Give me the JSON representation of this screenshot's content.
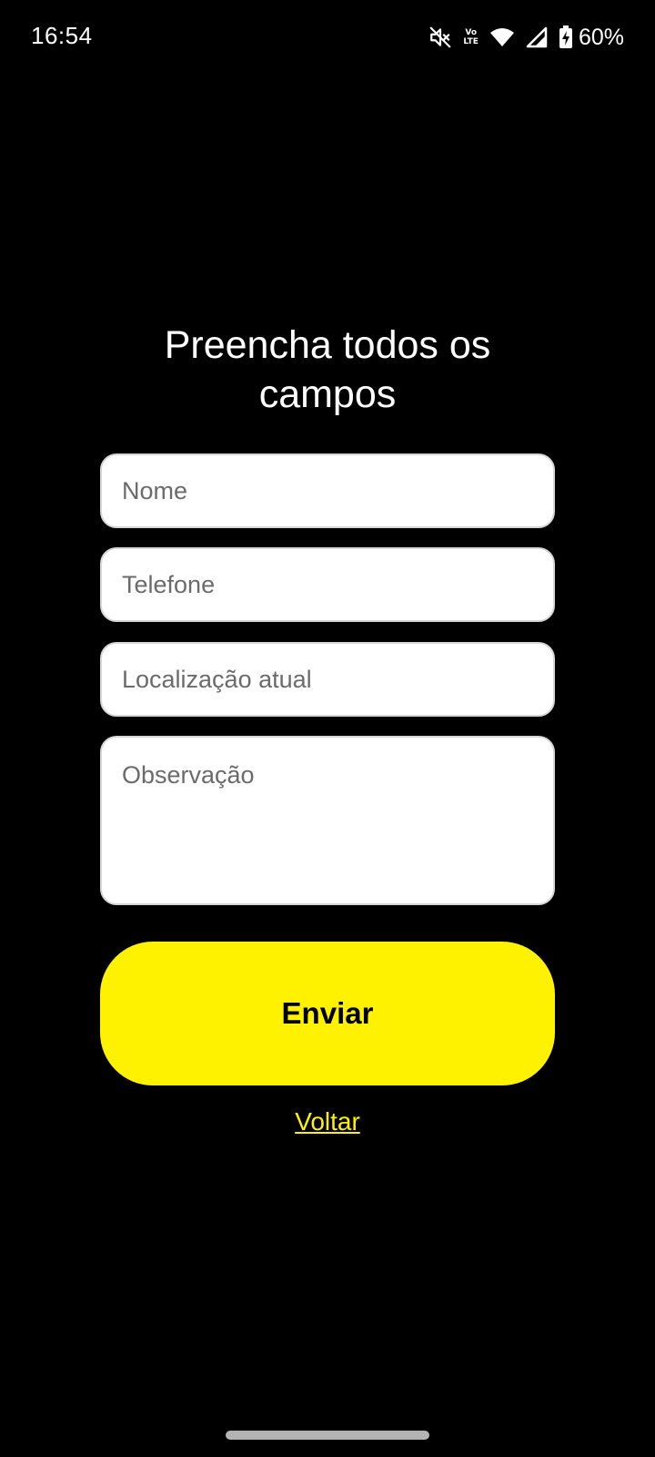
{
  "status_bar": {
    "time": "16:54",
    "volte_top": "Vo",
    "volte_bottom": "LTE",
    "battery_percent": "60%",
    "icons": [
      "mute-icon",
      "volte-icon",
      "wifi-icon",
      "signal-icon",
      "battery-charging-icon"
    ]
  },
  "form": {
    "title": "Preencha todos os campos",
    "fields": {
      "nome": {
        "placeholder": "Nome",
        "value": ""
      },
      "telefone": {
        "placeholder": "Telefone",
        "value": ""
      },
      "localizacao": {
        "placeholder": "Localização atual",
        "value": ""
      },
      "observacao": {
        "placeholder": "Observação",
        "value": ""
      }
    },
    "submit_label": "Enviar",
    "back_label": "Voltar"
  },
  "colors": {
    "background": "#000000",
    "accent": "#fff200",
    "field_background": "#ffffff",
    "placeholder": "#6b6b6b"
  }
}
